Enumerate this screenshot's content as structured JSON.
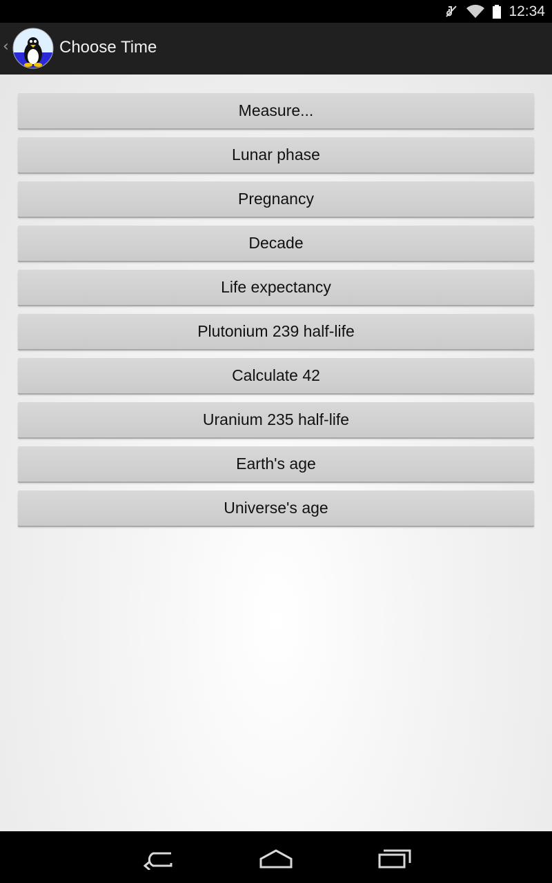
{
  "status_bar": {
    "time": "12:34",
    "icons": [
      "mute-icon",
      "wifi-icon",
      "battery-icon"
    ]
  },
  "action_bar": {
    "title": "Choose Time",
    "up_icon": "back-caret-icon",
    "app_icon": "penguin-logo-icon"
  },
  "buttons": [
    "Measure...",
    "Lunar phase",
    "Pregnancy",
    "Decade",
    "Life expectancy",
    "Plutonium 239 half-life",
    "Calculate 42",
    "Uranium 235 half-life",
    "Earth's age",
    "Universe's age"
  ],
  "nav_bar": {
    "icons": [
      "back-icon",
      "home-icon",
      "recents-icon"
    ]
  },
  "colors": {
    "status_bar": "#000000",
    "action_bar": "#202020",
    "button": "#d0d0d0",
    "content_bg": "#f4f4f4"
  }
}
